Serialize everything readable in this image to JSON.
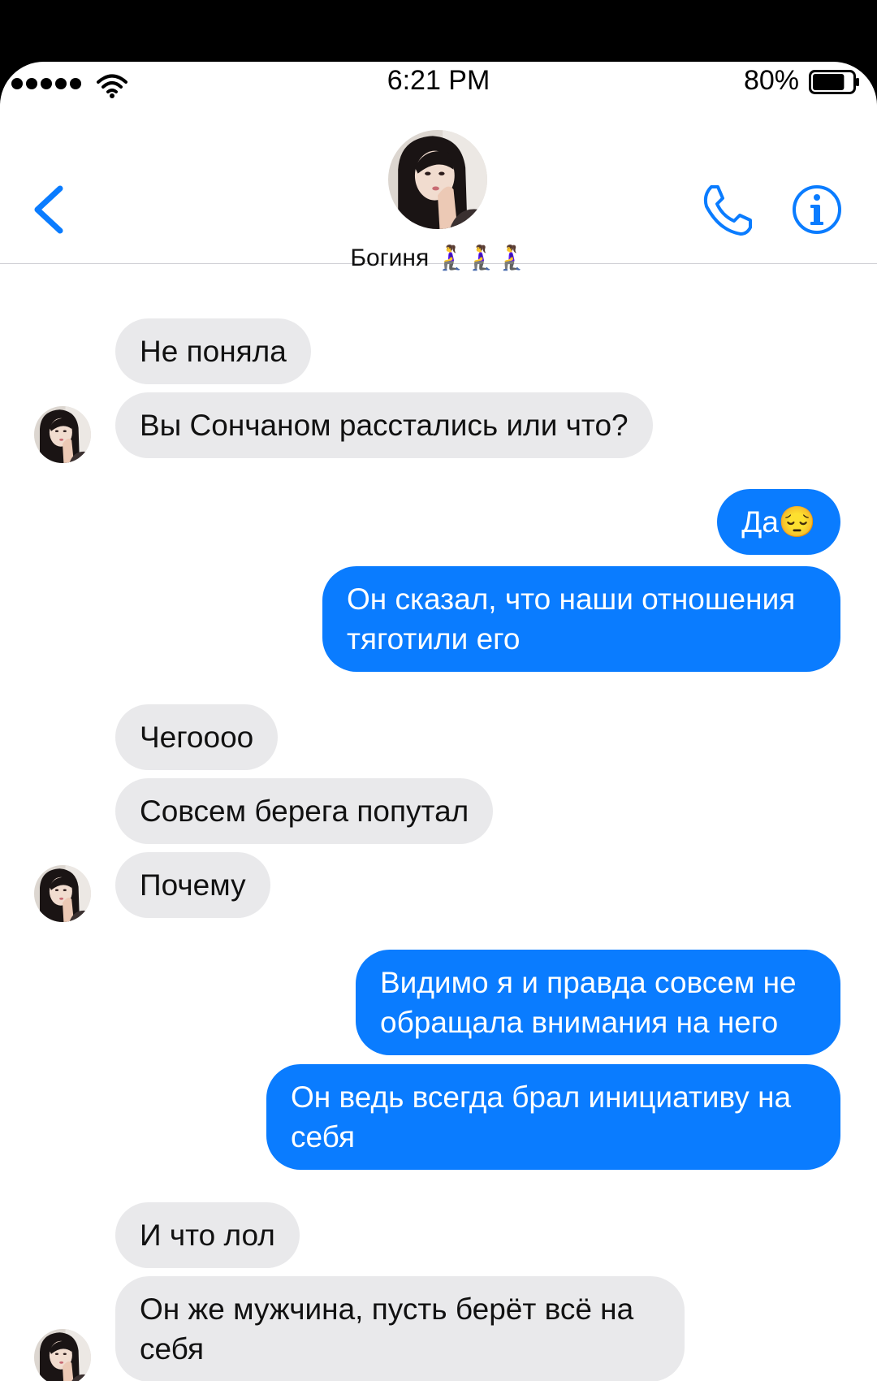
{
  "status_bar": {
    "time": "6:21 PM",
    "battery": "80%",
    "battery_level": 0.8
  },
  "header": {
    "contact_name": "Богиня 🧎‍♀️🧎‍♀️🧎‍♀️",
    "back_icon": "chevron-left-icon",
    "call_icon": "phone-icon",
    "info_icon": "info-icon"
  },
  "messages": [
    {
      "from": "them",
      "text": "Не поняла"
    },
    {
      "from": "them",
      "text": "Вы Сончаном расстались или что?"
    },
    {
      "from": "me",
      "text": "Да😔"
    },
    {
      "from": "me",
      "text": "Он сказал, что наши отношения тяготили его"
    },
    {
      "from": "them",
      "text": "Чегоооо"
    },
    {
      "from": "them",
      "text": "Совсем берега попутал"
    },
    {
      "from": "them",
      "text": "Почему"
    },
    {
      "from": "me",
      "text": "Видимо я и правда совсем не обращала внимания на него"
    },
    {
      "from": "me",
      "text": "Он ведь всегда брал инициативу на себя"
    },
    {
      "from": "them",
      "text": "И что лол"
    },
    {
      "from": "them",
      "text": "Он же мужчина, пусть берёт всё на себя"
    }
  ],
  "colors": {
    "incoming_bubble": "#e9e9eb",
    "outgoing_bubble": "#0a7cff",
    "accent": "#0a7cff"
  }
}
